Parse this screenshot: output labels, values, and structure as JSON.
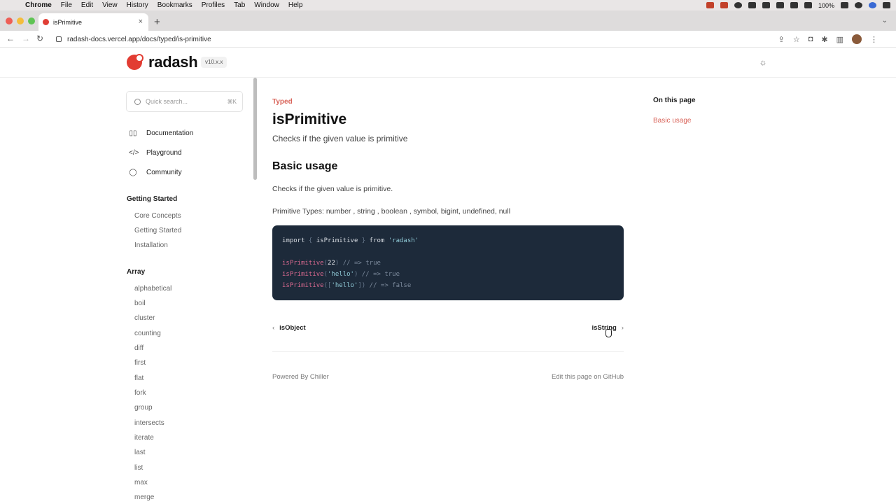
{
  "menubar": {
    "app": "Chrome",
    "items": [
      "File",
      "Edit",
      "View",
      "History",
      "Bookmarks",
      "Profiles",
      "Tab",
      "Window",
      "Help"
    ],
    "battery": "100%"
  },
  "browser": {
    "tab_title": "isPrimitive",
    "new_tab": "+",
    "url": "radash-docs.vercel.app/docs/typed/is-primitive"
  },
  "header": {
    "logo_text": "radash",
    "version": "v10.x.x"
  },
  "sidebar": {
    "search_placeholder": "Quick search...",
    "search_shortcut": "⌘K",
    "links": [
      {
        "label": "Documentation",
        "icon": "book-icon"
      },
      {
        "label": "Playground",
        "icon": "code-icon"
      },
      {
        "label": "Community",
        "icon": "chat-icon"
      }
    ],
    "sections": [
      {
        "title": "Getting Started",
        "items": [
          "Core Concepts",
          "Getting Started",
          "Installation"
        ]
      },
      {
        "title": "Array",
        "items": [
          "alphabetical",
          "boil",
          "cluster",
          "counting",
          "diff",
          "first",
          "flat",
          "fork",
          "group",
          "intersects",
          "iterate",
          "last",
          "list",
          "max",
          "merge"
        ]
      }
    ]
  },
  "main": {
    "category": "Typed",
    "title": "isPrimitive",
    "lead": "Checks if the given value is primitive",
    "h2": "Basic usage",
    "p1": "Checks if the given value is primitive.",
    "p2": "Primitive Types: number , string , boolean , symbol, bigint, undefined, null",
    "code": {
      "l1": [
        "import",
        " { ",
        "isPrimitive",
        " } ",
        "from",
        " 'radash'"
      ],
      "l2": [
        "isPrimitive",
        "(",
        "22",
        ")",
        " // => true"
      ],
      "l3": [
        "isPrimitive",
        "(",
        "'hello'",
        ")",
        " // => true"
      ],
      "l4": [
        "isPrimitive",
        "([",
        "'hello'",
        "])",
        " // => false"
      ]
    },
    "prev": "isObject",
    "next": "isString",
    "footer_left": "Powered By Chiller",
    "footer_right": "Edit this page on GitHub"
  },
  "toc": {
    "title": "On this page",
    "link": "Basic usage"
  }
}
